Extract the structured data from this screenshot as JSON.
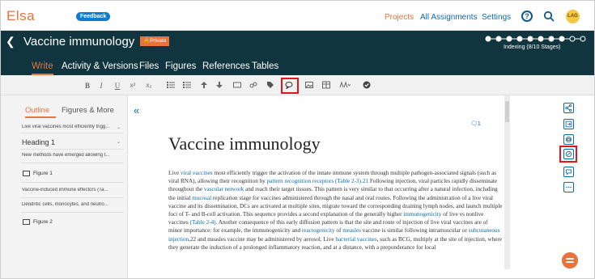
{
  "app": {
    "name": "Elsa",
    "feedback": "Feedback"
  },
  "topnav": {
    "projects": "Projects",
    "assignments": "All Assignments",
    "settings": "Settings",
    "help": "?",
    "avatar": "LAG"
  },
  "header": {
    "title": "Vaccine immunology",
    "badge": "Private",
    "indexing": "Indexing (8/10 Stages)",
    "stages_total": 10,
    "stages_done": 8,
    "tabs": [
      "Write",
      "Activity & Versions",
      "Files",
      "Figures",
      "References",
      "Tables"
    ],
    "active_tab": "Write"
  },
  "toolbar": {
    "bold": "B",
    "italic": "I",
    "underline": "U",
    "superscript": "x²",
    "subscript": "x₂"
  },
  "leftpanel": {
    "tabs": [
      "Outline",
      "Figures & More"
    ],
    "items": {
      "i1": "Live viral vaccines most efficiently trigg...",
      "heading": "Heading 1",
      "i2": "New methods have emerged allowing t...",
      "fig1": "Figure 1",
      "i3": "Vaccine-induced immune effectors (Ta...",
      "i4": "Dendritic cells, monocytes, and neutro...",
      "fig2": "Figure 2"
    }
  },
  "main": {
    "comment_count": "1",
    "title": "Vaccine immunology",
    "para": {
      "p01": "Live ",
      "l01": "viral vaccines",
      "p02": " most efficiently trigger the activation of the innate immune system through multiple pathogen-associated signals (such as viral RNA), allowing their recognition by ",
      "l02": "pattern recognition receptors",
      "p03": " ",
      "l03": "(Table 2-3).21",
      "p04": " Following injection, viral particles rapidly disseminate throughout the ",
      "l04": "vascular network",
      "p05": " and reach their target tissues. This pattern is very similar to that occurring after a natural infection, including the initial ",
      "l05": "mucosal",
      "p06": " replication stage for vaccines administered through the nasal and oral routes. Following the administration of a live viral vaccine and its dissemination, DCs are activated at multiple sites, migrate toward the corresponding draining lymph nodes, and launch multiple foci of T- and B-cell activation. This sequence provides a second explanation of the generally higher ",
      "l06": "immunogenicity",
      "p07": " of live vs nonlive vaccines ",
      "l07": "(Table 2-4)",
      "p08": ". Another consequence of this early diffusion pattern is that the site and route of injection of live viral vaccines are of minor importance: for example, the immunogenicity and ",
      "l08": "reactogenicity",
      "p09": " of ",
      "l09": "measles",
      "p10": " vaccine is similar following intramuscular or ",
      "l10": "subcutaneous injection",
      "p11": ",22 and measles vaccine may be administered by aerosol. Live ",
      "l11": "bacterial vaccines",
      "p12": ", such as BCG, multiply at the site of injection, where they generate the induction of a prolonged inflammatory reaction, and at a distance, with a preponderance for local"
    }
  },
  "colors": {
    "accent": "#e8743b",
    "header_bg": "#10353f",
    "link": "#0c6aa8",
    "highlight": "#e0161c"
  }
}
